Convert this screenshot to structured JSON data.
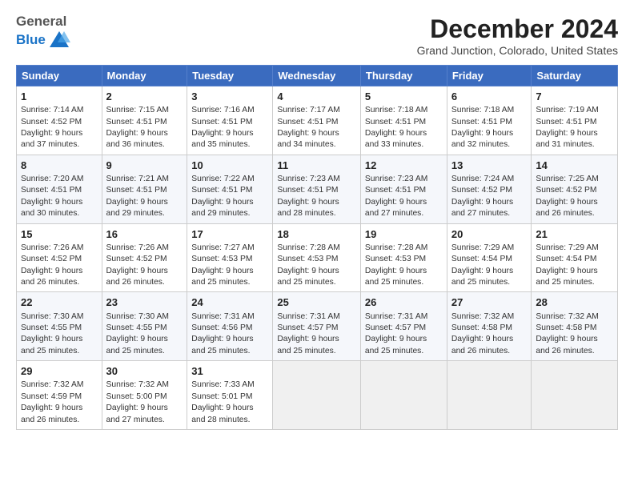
{
  "logo": {
    "general": "General",
    "blue": "Blue"
  },
  "title": "December 2024",
  "location": "Grand Junction, Colorado, United States",
  "days_of_week": [
    "Sunday",
    "Monday",
    "Tuesday",
    "Wednesday",
    "Thursday",
    "Friday",
    "Saturday"
  ],
  "weeks": [
    [
      {
        "day": "1",
        "lines": [
          "Sunrise: 7:14 AM",
          "Sunset: 4:52 PM",
          "Daylight: 9 hours",
          "and 37 minutes."
        ]
      },
      {
        "day": "2",
        "lines": [
          "Sunrise: 7:15 AM",
          "Sunset: 4:51 PM",
          "Daylight: 9 hours",
          "and 36 minutes."
        ]
      },
      {
        "day": "3",
        "lines": [
          "Sunrise: 7:16 AM",
          "Sunset: 4:51 PM",
          "Daylight: 9 hours",
          "and 35 minutes."
        ]
      },
      {
        "day": "4",
        "lines": [
          "Sunrise: 7:17 AM",
          "Sunset: 4:51 PM",
          "Daylight: 9 hours",
          "and 34 minutes."
        ]
      },
      {
        "day": "5",
        "lines": [
          "Sunrise: 7:18 AM",
          "Sunset: 4:51 PM",
          "Daylight: 9 hours",
          "and 33 minutes."
        ]
      },
      {
        "day": "6",
        "lines": [
          "Sunrise: 7:18 AM",
          "Sunset: 4:51 PM",
          "Daylight: 9 hours",
          "and 32 minutes."
        ]
      },
      {
        "day": "7",
        "lines": [
          "Sunrise: 7:19 AM",
          "Sunset: 4:51 PM",
          "Daylight: 9 hours",
          "and 31 minutes."
        ]
      }
    ],
    [
      {
        "day": "8",
        "lines": [
          "Sunrise: 7:20 AM",
          "Sunset: 4:51 PM",
          "Daylight: 9 hours",
          "and 30 minutes."
        ]
      },
      {
        "day": "9",
        "lines": [
          "Sunrise: 7:21 AM",
          "Sunset: 4:51 PM",
          "Daylight: 9 hours",
          "and 29 minutes."
        ]
      },
      {
        "day": "10",
        "lines": [
          "Sunrise: 7:22 AM",
          "Sunset: 4:51 PM",
          "Daylight: 9 hours",
          "and 29 minutes."
        ]
      },
      {
        "day": "11",
        "lines": [
          "Sunrise: 7:23 AM",
          "Sunset: 4:51 PM",
          "Daylight: 9 hours",
          "and 28 minutes."
        ]
      },
      {
        "day": "12",
        "lines": [
          "Sunrise: 7:23 AM",
          "Sunset: 4:51 PM",
          "Daylight: 9 hours",
          "and 27 minutes."
        ]
      },
      {
        "day": "13",
        "lines": [
          "Sunrise: 7:24 AM",
          "Sunset: 4:52 PM",
          "Daylight: 9 hours",
          "and 27 minutes."
        ]
      },
      {
        "day": "14",
        "lines": [
          "Sunrise: 7:25 AM",
          "Sunset: 4:52 PM",
          "Daylight: 9 hours",
          "and 26 minutes."
        ]
      }
    ],
    [
      {
        "day": "15",
        "lines": [
          "Sunrise: 7:26 AM",
          "Sunset: 4:52 PM",
          "Daylight: 9 hours",
          "and 26 minutes."
        ]
      },
      {
        "day": "16",
        "lines": [
          "Sunrise: 7:26 AM",
          "Sunset: 4:52 PM",
          "Daylight: 9 hours",
          "and 26 minutes."
        ]
      },
      {
        "day": "17",
        "lines": [
          "Sunrise: 7:27 AM",
          "Sunset: 4:53 PM",
          "Daylight: 9 hours",
          "and 25 minutes."
        ]
      },
      {
        "day": "18",
        "lines": [
          "Sunrise: 7:28 AM",
          "Sunset: 4:53 PM",
          "Daylight: 9 hours",
          "and 25 minutes."
        ]
      },
      {
        "day": "19",
        "lines": [
          "Sunrise: 7:28 AM",
          "Sunset: 4:53 PM",
          "Daylight: 9 hours",
          "and 25 minutes."
        ]
      },
      {
        "day": "20",
        "lines": [
          "Sunrise: 7:29 AM",
          "Sunset: 4:54 PM",
          "Daylight: 9 hours",
          "and 25 minutes."
        ]
      },
      {
        "day": "21",
        "lines": [
          "Sunrise: 7:29 AM",
          "Sunset: 4:54 PM",
          "Daylight: 9 hours",
          "and 25 minutes."
        ]
      }
    ],
    [
      {
        "day": "22",
        "lines": [
          "Sunrise: 7:30 AM",
          "Sunset: 4:55 PM",
          "Daylight: 9 hours",
          "and 25 minutes."
        ]
      },
      {
        "day": "23",
        "lines": [
          "Sunrise: 7:30 AM",
          "Sunset: 4:55 PM",
          "Daylight: 9 hours",
          "and 25 minutes."
        ]
      },
      {
        "day": "24",
        "lines": [
          "Sunrise: 7:31 AM",
          "Sunset: 4:56 PM",
          "Daylight: 9 hours",
          "and 25 minutes."
        ]
      },
      {
        "day": "25",
        "lines": [
          "Sunrise: 7:31 AM",
          "Sunset: 4:57 PM",
          "Daylight: 9 hours",
          "and 25 minutes."
        ]
      },
      {
        "day": "26",
        "lines": [
          "Sunrise: 7:31 AM",
          "Sunset: 4:57 PM",
          "Daylight: 9 hours",
          "and 25 minutes."
        ]
      },
      {
        "day": "27",
        "lines": [
          "Sunrise: 7:32 AM",
          "Sunset: 4:58 PM",
          "Daylight: 9 hours",
          "and 26 minutes."
        ]
      },
      {
        "day": "28",
        "lines": [
          "Sunrise: 7:32 AM",
          "Sunset: 4:58 PM",
          "Daylight: 9 hours",
          "and 26 minutes."
        ]
      }
    ],
    [
      {
        "day": "29",
        "lines": [
          "Sunrise: 7:32 AM",
          "Sunset: 4:59 PM",
          "Daylight: 9 hours",
          "and 26 minutes."
        ]
      },
      {
        "day": "30",
        "lines": [
          "Sunrise: 7:32 AM",
          "Sunset: 5:00 PM",
          "Daylight: 9 hours",
          "and 27 minutes."
        ]
      },
      {
        "day": "31",
        "lines": [
          "Sunrise: 7:33 AM",
          "Sunset: 5:01 PM",
          "Daylight: 9 hours",
          "and 28 minutes."
        ]
      },
      null,
      null,
      null,
      null
    ]
  ]
}
